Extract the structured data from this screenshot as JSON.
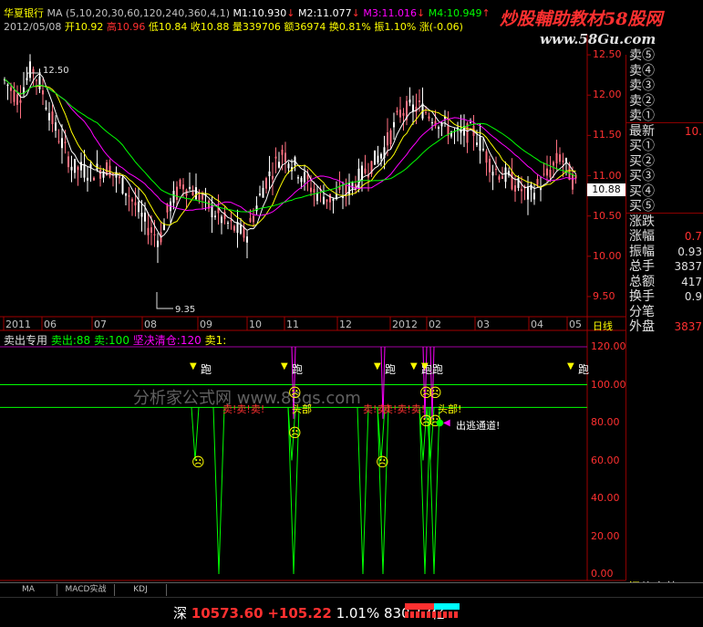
{
  "header": {
    "stock_name": "华夏银行",
    "ma_params": "MA (5,10,20,30,60,120,240,360,4,1)",
    "ma_values": [
      {
        "label": "M1:10.930",
        "color": "#ffffff"
      },
      {
        "label": "M2:11.077",
        "color": "#ffffff"
      },
      {
        "label": "M3:11.016",
        "color": "#ff00ff"
      },
      {
        "label": "M4:10.949",
        "color": "#00ff00"
      }
    ],
    "date": "2012/05/08",
    "open": "开10.92",
    "high": "高10.96",
    "low": "低10.84",
    "close": "收10.88",
    "volume": "量339706",
    "amount": "额36974",
    "turnover": "换0.81%",
    "amplitude": "振1.10%",
    "change": "涨(-0.06)"
  },
  "watermark": {
    "title": "炒股輔助教材58股网",
    "url": "www.58Gu.com",
    "center": "分析家公式网 www.88gs.com"
  },
  "price_axis": {
    "ticks": [
      "12.50",
      "12.00",
      "11.50",
      "11.00",
      "10.50",
      "10.00",
      "9.50"
    ],
    "current_price": "10.88",
    "high_label": "12.50",
    "low_label": "9.35"
  },
  "time_axis": {
    "labels": [
      "2011",
      "06",
      "07",
      "08",
      "09",
      "10",
      "11",
      "12",
      "2012",
      "02",
      "03",
      "04",
      "05"
    ],
    "period_label": "日线"
  },
  "indicator": {
    "name": "卖出专用",
    "params": [
      {
        "text": "卖出:88",
        "color": "#00ff00"
      },
      {
        "text": "卖:100",
        "color": "#00ff00"
      },
      {
        "text": "坚决清仓:120",
        "color": "#ff00ff"
      },
      {
        "text": "卖1:",
        "color": "#ffff00"
      }
    ],
    "axis_ticks": [
      "120.00",
      "100.00",
      "80.00",
      "60.00",
      "40.00",
      "20.00",
      "0.00"
    ],
    "run_label": "跑",
    "sell_labels": [
      "卖!卖!卖!",
      "卖!卖!",
      "卖!卖!卖!",
      "头部",
      "卖!卖!卖!",
      "头部!",
      "出逃通道!"
    ]
  },
  "quote_panel": {
    "rows": [
      {
        "label": "卖⑤",
        "value": ""
      },
      {
        "label": "卖④",
        "value": ""
      },
      {
        "label": "卖③",
        "value": ""
      },
      {
        "label": "卖②",
        "value": ""
      },
      {
        "label": "卖①",
        "value": ""
      },
      {
        "label": "最新",
        "value": "10."
      },
      {
        "label": "买①",
        "value": ""
      },
      {
        "label": "买②",
        "value": ""
      },
      {
        "label": "买③",
        "value": ""
      },
      {
        "label": "买④",
        "value": ""
      },
      {
        "label": "买⑤",
        "value": ""
      },
      {
        "label": "涨跌",
        "value": ""
      },
      {
        "label": "涨幅",
        "value": "0.7"
      },
      {
        "label": "振幅",
        "value": "0.93"
      },
      {
        "label": "总手",
        "value": "3837"
      },
      {
        "label": "总额",
        "value": "417"
      },
      {
        "label": "换手",
        "value": "0.9"
      },
      {
        "label": "分笔",
        "value": ""
      },
      {
        "label": "外盘",
        "value": "3837"
      }
    ],
    "bottom_tabs": [
      "细",
      "价",
      "盘",
      "势"
    ]
  },
  "bottom_tabs": [
    "MA",
    "MACD实战",
    "KDJ"
  ],
  "status_bar": {
    "index_name": "深",
    "index_value": "10573.60",
    "index_change": "+105.22",
    "index_pct": "1.01%",
    "index_amount": "830.17亿"
  },
  "colors": {
    "red": "#ff3030",
    "green": "#00ff00",
    "yellow": "#ffff00",
    "magenta": "#ff00ff",
    "white": "#ffffff",
    "axis_red": "#a00000",
    "cyan": "#00ffff"
  }
}
